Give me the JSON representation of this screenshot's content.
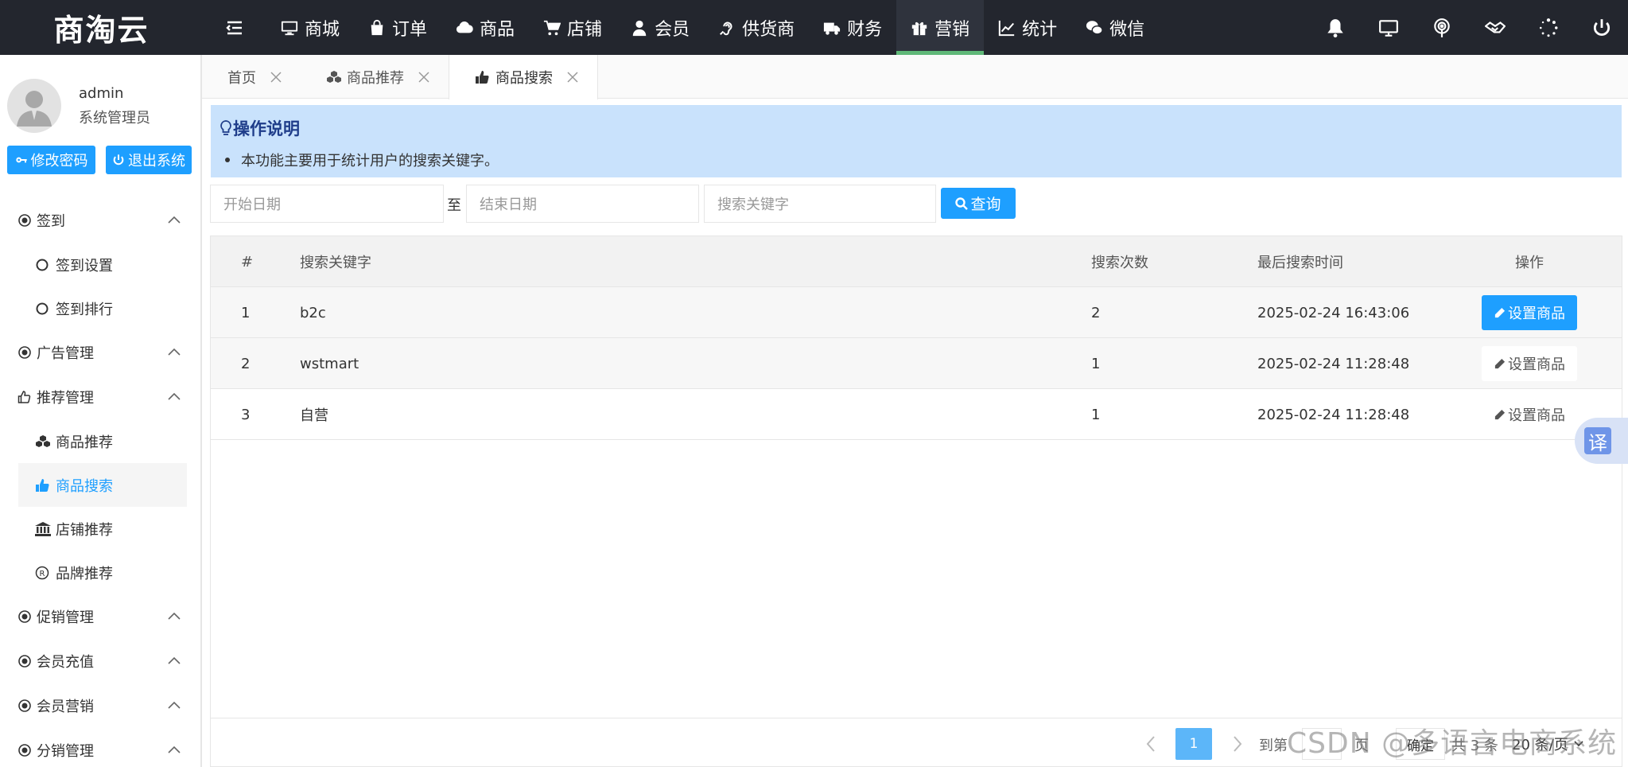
{
  "app": {
    "logo": "商淘云"
  },
  "topnav": {
    "items": [
      {
        "label": "商城",
        "icon": "monitor-icon"
      },
      {
        "label": "订单",
        "icon": "shopping-bag-icon"
      },
      {
        "label": "商品",
        "icon": "cloud-icon"
      },
      {
        "label": "店铺",
        "icon": "cart-icon"
      },
      {
        "label": "会员",
        "icon": "user-icon"
      },
      {
        "label": "供货商",
        "icon": "hearing-icon"
      },
      {
        "label": "财务",
        "icon": "truck-icon"
      },
      {
        "label": "营销",
        "icon": "gift-icon"
      },
      {
        "label": "统计",
        "icon": "line-chart-icon"
      },
      {
        "label": "微信",
        "icon": "wechat-icon"
      }
    ],
    "active": "营销",
    "active_color": "#5fb878"
  },
  "user": {
    "name": "admin",
    "role": "系统管理员",
    "change_pwd": "修改密码",
    "logout": "退出系统"
  },
  "sidebar": {
    "g_sign": "签到",
    "sign_settings": "签到设置",
    "sign_rank": "签到排行",
    "g_ad": "广告管理",
    "g_recommend": "推荐管理",
    "rec_goods": "商品推荐",
    "rec_search": "商品搜索",
    "rec_shop": "店铺推荐",
    "rec_brand": "品牌推荐",
    "g_promo": "促销管理",
    "g_recharge": "会员充值",
    "g_marketing": "会员营销",
    "g_distribution": "分销管理"
  },
  "tabs": {
    "home": "首页",
    "goods_rec": "商品推荐",
    "goods_search": "商品搜索"
  },
  "notice": {
    "title": "操作说明",
    "item": "本功能主要用于统计用户的搜索关键字。"
  },
  "search": {
    "start_placeholder": "开始日期",
    "separator": "至",
    "end_placeholder": "结束日期",
    "keyword_placeholder": "搜索关键字",
    "button": "查询"
  },
  "table": {
    "headers": {
      "idx": "#",
      "keyword": "搜索关键字",
      "count": "搜索次数",
      "last_time": "最后搜索时间",
      "op": "操作"
    },
    "rows": [
      {
        "idx": "1",
        "keyword": "b2c",
        "count": "2",
        "last_time": "2025-02-24 16:43:06",
        "op": "设置商品"
      },
      {
        "idx": "2",
        "keyword": "wstmart",
        "count": "1",
        "last_time": "2025-02-24 11:28:48",
        "op": "设置商品"
      },
      {
        "idx": "3",
        "keyword": "自营",
        "count": "1",
        "last_time": "2025-02-24 11:28:48",
        "op": "设置商品"
      }
    ]
  },
  "pager": {
    "current": "1",
    "goto_label": "到第",
    "page_unit": "页",
    "confirm": "确定",
    "total": "共 3 条",
    "page_size": "20 条/页"
  },
  "watermark": "CSDN @多语言电商系统",
  "translate": "译",
  "colors": {
    "primary": "#1e9fff",
    "topbar": "#23262e",
    "notice_bg": "#c9e2fc"
  }
}
